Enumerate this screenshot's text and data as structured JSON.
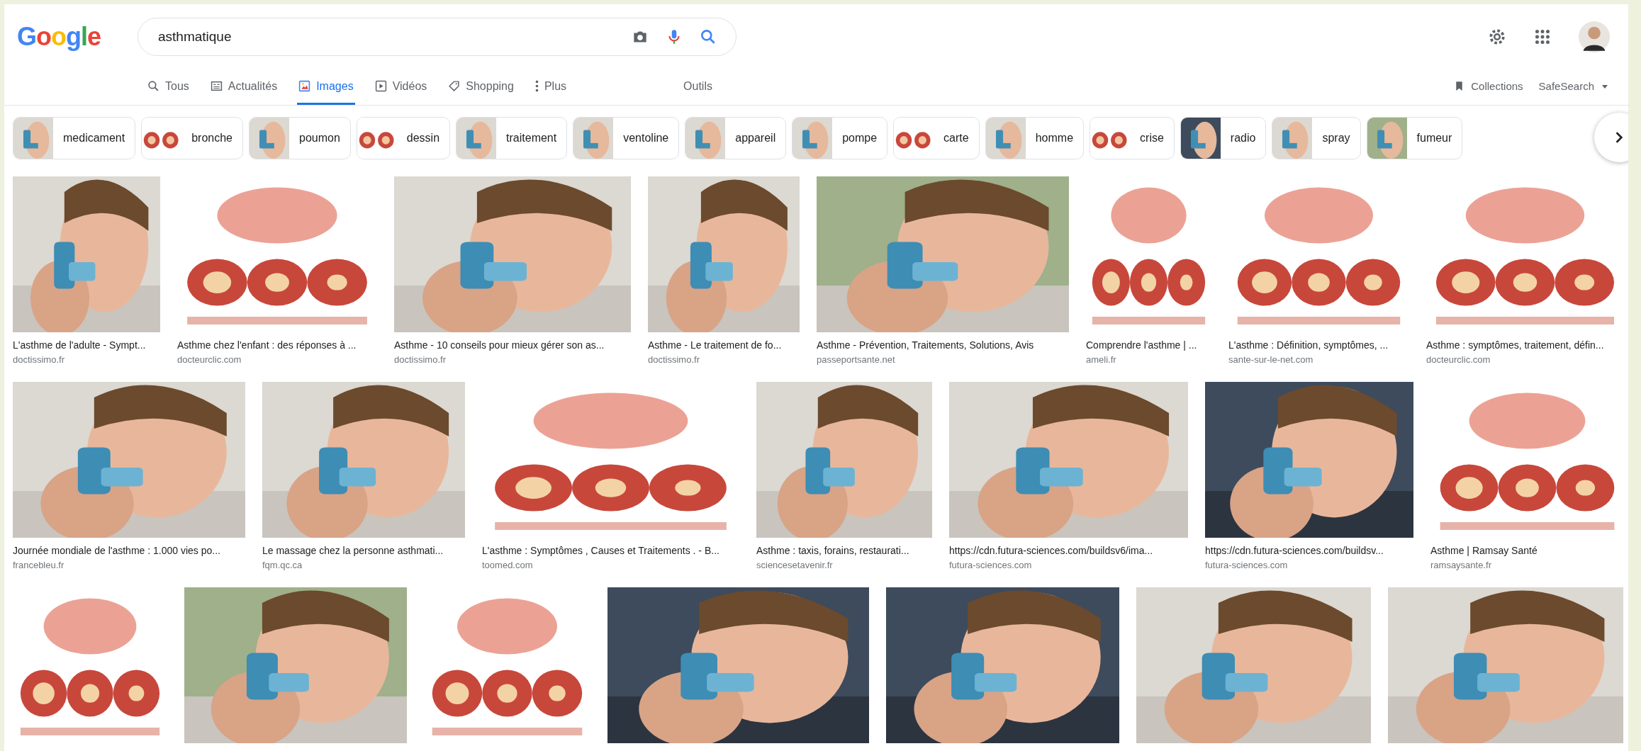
{
  "logo": "Google",
  "search": {
    "value": "asthmatique"
  },
  "tabs": [
    {
      "label": "Tous",
      "selected": false
    },
    {
      "label": "Actualités",
      "selected": false
    },
    {
      "label": "Images",
      "selected": true
    },
    {
      "label": "Vidéos",
      "selected": false
    },
    {
      "label": "Shopping",
      "selected": false
    },
    {
      "label": "Plus",
      "selected": false
    }
  ],
  "tools": "Outils",
  "collections": "Collections",
  "safesearch": "SafeSearch",
  "chips": [
    "medicament",
    "bronche",
    "poumon",
    "dessin",
    "traitement",
    "ventoline",
    "appareil",
    "pompe",
    "carte",
    "homme",
    "crise",
    "radio",
    "spray",
    "fumeur"
  ],
  "rows": [
    {
      "items": [
        {
          "title": "L'asthme de l'adulte - Sympt...",
          "source": "doctissimo.fr"
        },
        {
          "title": "Asthme chez l'enfant : des réponses à ...",
          "source": "docteurclic.com"
        },
        {
          "title": "Asthme - 10 conseils pour mieux gérer son as...",
          "source": "doctissimo.fr"
        },
        {
          "title": "Asthme - Le traitement de fo...",
          "source": "doctissimo.fr"
        },
        {
          "title": "Asthme - Prévention, Traitements, Solutions, Avis",
          "source": "passeportsante.net"
        },
        {
          "title": "Comprendre l'asthme | ...",
          "source": "ameli.fr"
        },
        {
          "title": "L'asthme : Définition, symptômes, ...",
          "source": "sante-sur-le-net.com"
        },
        {
          "title": "Asthme : symptômes, traitement, défin...",
          "source": "docteurclic.com"
        }
      ]
    },
    {
      "items": [
        {
          "title": "Journée mondiale de l'asthme : 1.000 vies po...",
          "source": "francebleu.fr"
        },
        {
          "title": "Le massage chez la personne asthmati...",
          "source": "fqm.qc.ca"
        },
        {
          "title": "L'asthme : Symptômes , Causes et Traitements . - B...",
          "source": "toomed.com"
        },
        {
          "title": "Asthme : taxis, forains, restaurati...",
          "source": "sciencesetavenir.fr"
        },
        {
          "title": "https://cdn.futura-sciences.com/buildsv6/ima...",
          "source": "futura-sciences.com"
        },
        {
          "title": "https://cdn.futura-sciences.com/buildsv...",
          "source": "futura-sciences.com"
        },
        {
          "title": "Asthme | Ramsay Santé",
          "source": "ramsaysante.fr"
        }
      ]
    },
    {
      "items": [
        {
          "kind": "picture"
        },
        {
          "kind": "picture"
        },
        {
          "kind": "picture"
        },
        {
          "kind": "picture"
        },
        {
          "kind": "picture"
        },
        {
          "kind": "picture"
        },
        {
          "kind": "picture"
        }
      ]
    }
  ]
}
